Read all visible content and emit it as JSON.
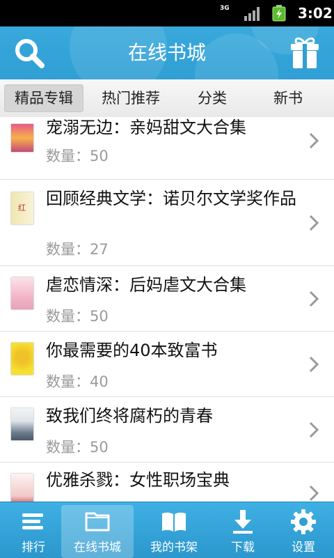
{
  "status_bar": {
    "network": "3G",
    "time": "3:02"
  },
  "header": {
    "title": "在线书城"
  },
  "tabs": [
    {
      "label": "精品专辑",
      "active": true
    },
    {
      "label": "热门推荐",
      "active": false
    },
    {
      "label": "分类",
      "active": false
    },
    {
      "label": "新书",
      "active": false
    }
  ],
  "list": [
    {
      "title": "宠溺无边：亲妈甜文大合集",
      "count": "数量：50"
    },
    {
      "title": "回顾经典文学：诺贝尔文学奖作品",
      "count": "数量：27",
      "cover_text": "红"
    },
    {
      "title": "虐恋情深：后妈虐文大合集",
      "count": "数量：50"
    },
    {
      "title": "你最需要的40本致富书",
      "count": "数量：40"
    },
    {
      "title": "致我们终将腐朽的青春",
      "count": "数量：50"
    },
    {
      "title": "优雅杀戮：女性职场宝典",
      "count": ""
    }
  ],
  "bottom_nav": [
    {
      "label": "排行",
      "icon": "list-icon",
      "active": false
    },
    {
      "label": "在线书城",
      "icon": "folder-icon",
      "active": true
    },
    {
      "label": "我的书架",
      "icon": "book-icon",
      "active": false
    },
    {
      "label": "下载",
      "icon": "download-icon",
      "active": false
    },
    {
      "label": "设置",
      "icon": "gear-icon",
      "active": false
    }
  ],
  "colors": {
    "accent": "#2f9fd4",
    "tab_active": "#d6d6d6",
    "muted_text": "#9a9a9a"
  }
}
